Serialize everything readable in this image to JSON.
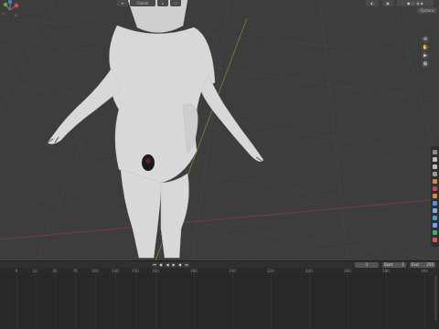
{
  "header": {
    "widget_label": "Global"
  },
  "viewport": {
    "options_label": "Options",
    "gizmo": {
      "x": "X",
      "y": "Y",
      "z": "Z"
    },
    "nav_buttons": [
      "zoom-icon",
      "hand-icon",
      "camera-icon",
      "grid-icon"
    ],
    "colors": {
      "background": "#3d3d3d",
      "grid": "#474747",
      "x_axis": "#8a3b3b",
      "y_axis": "#6b8a3a",
      "model": "#d8d8d8"
    }
  },
  "timeline": {
    "current_frame": "1",
    "start_label": "Start",
    "start_value": "1",
    "end_label": "End",
    "end_value": "250",
    "ruler_ticks": [
      "0",
      "10",
      "40",
      "70",
      "100",
      "130",
      "150",
      "160",
      "180",
      "200",
      "220",
      "240",
      "260",
      "280",
      "300"
    ],
    "play_icons": [
      "jump-start-icon",
      "prev-key-icon",
      "play-reverse-icon",
      "play-icon",
      "next-key-icon",
      "jump-end-icon"
    ]
  },
  "properties": {
    "tab_icons": [
      "tool-icon",
      "render-icon",
      "output-icon",
      "view-layer-icon",
      "scene-icon",
      "world-icon",
      "object-icon",
      "modifier-icon",
      "particles-icon",
      "physics-icon",
      "constraints-icon",
      "data-icon",
      "material-icon",
      "texture-icon"
    ]
  }
}
